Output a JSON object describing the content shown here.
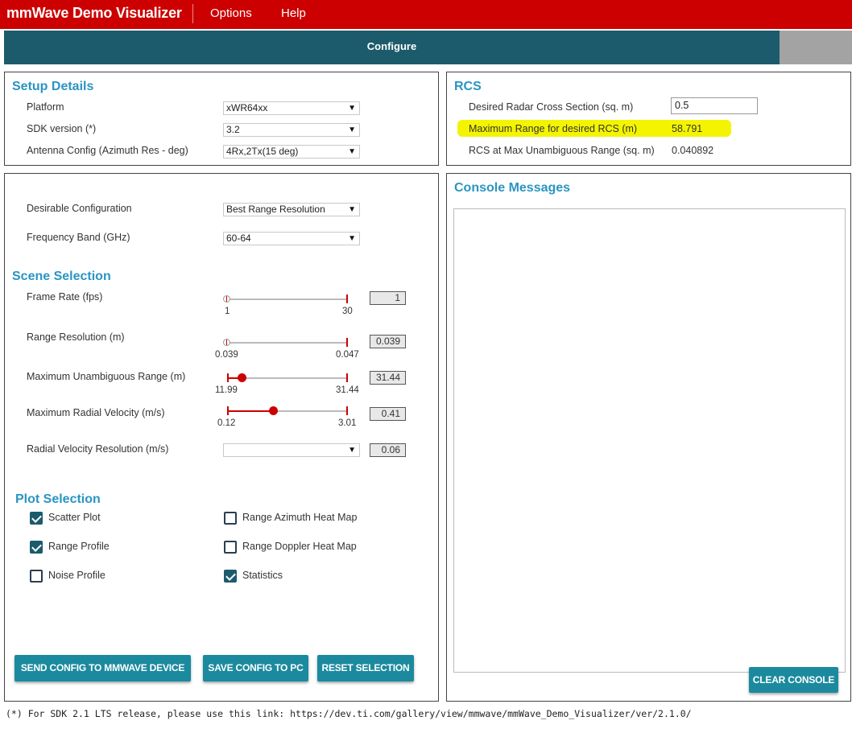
{
  "app": {
    "title": "mmWave Demo Visualizer",
    "menu": [
      "Options",
      "Help"
    ]
  },
  "tabs": {
    "configure": "Configure"
  },
  "setup": {
    "title": "Setup Details",
    "platform_label": "Platform",
    "platform_value": "xWR64xx",
    "sdk_label": "SDK version (*)",
    "sdk_value": "3.2",
    "antenna_label": "Antenna Config (Azimuth Res - deg)",
    "antenna_value": "4Rx,2Tx(15 deg)"
  },
  "rcs": {
    "title": "RCS",
    "desired_label": "Desired Radar Cross Section (sq. m)",
    "desired_value": "0.5",
    "max_range_label": "Maximum Range for desired RCS (m)",
    "max_range_value": "58.791",
    "unamb_label": "RCS at Max Unambiguous Range (sq. m)",
    "unamb_value": "0.040892",
    "highlight_color": "#f4f400"
  },
  "config": {
    "desirable_label": "Desirable Configuration",
    "desirable_value": "Best Range Resolution",
    "freq_label": "Frequency Band (GHz)",
    "freq_value": "60-64"
  },
  "scene": {
    "title": "Scene Selection",
    "frame_rate": {
      "label": "Frame Rate (fps)",
      "min": "1",
      "max": "30",
      "value": "1"
    },
    "range_res": {
      "label": "Range Resolution (m)",
      "min": "0.039",
      "max": "0.047",
      "value": "0.039"
    },
    "max_range": {
      "label": "Maximum Unambiguous Range (m)",
      "min": "11.99",
      "max": "31.44",
      "value": "31.44",
      "level": 0.12
    },
    "max_vel": {
      "label": "Maximum Radial Velocity (m/s)",
      "min": "0.12",
      "max": "3.01",
      "value": "0.41",
      "level": 0.38
    },
    "vel_res": {
      "label": "Radial Velocity Resolution (m/s)",
      "select_value": "",
      "value": "0.06"
    }
  },
  "plots": {
    "title": "Plot Selection",
    "scatter": {
      "label": "Scatter Plot",
      "checked": true
    },
    "range_profile": {
      "label": "Range Profile",
      "checked": true
    },
    "noise_profile": {
      "label": "Noise Profile",
      "checked": false
    },
    "range_azimuth": {
      "label": "Range Azimuth Heat Map",
      "checked": false
    },
    "range_doppler": {
      "label": "Range Doppler Heat Map",
      "checked": false
    },
    "statistics": {
      "label": "Statistics",
      "checked": true
    }
  },
  "buttons": {
    "send": "SEND CONFIG TO MMWAVE DEVICE",
    "save": "SAVE CONFIG TO PC",
    "reset": "RESET SELECTION",
    "clear": "CLEAR CONSOLE"
  },
  "console": {
    "title": "Console Messages"
  },
  "footnote": "(*) For SDK 2.1 LTS release, please use this link: https://dev.ti.com/gallery/view/mmwave/mmWave_Demo_Visualizer/ver/2.1.0/",
  "colors": {
    "brand_red": "#cc0000",
    "tab_teal": "#1b5b6b",
    "button_teal": "#1b8a9e",
    "heading_blue": "#2a95c2"
  },
  "icons": {
    "dropdown": "caret-down-icon",
    "checkbox": "check-icon"
  }
}
